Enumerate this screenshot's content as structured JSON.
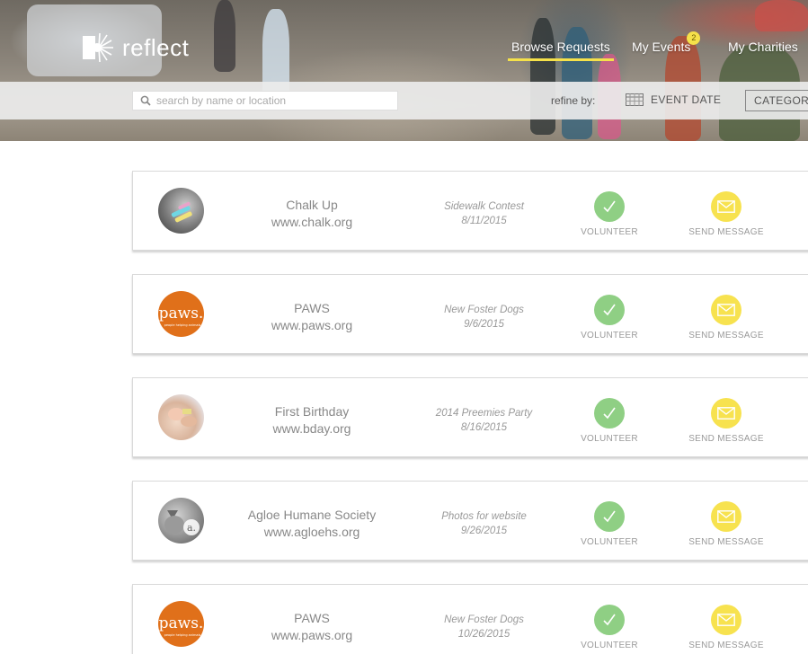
{
  "app": {
    "name": "reflect"
  },
  "nav": {
    "items": [
      {
        "label": "Browse Requests",
        "active": true
      },
      {
        "label": "My Events",
        "badge": "2"
      },
      {
        "label": "My Charities"
      }
    ]
  },
  "filters": {
    "search_placeholder": "search by name or location",
    "refine_label": "refine by:",
    "event_date_label": "EVENT DATE",
    "category_label": "CATEGORY"
  },
  "actions": {
    "volunteer_label": "VOLUNTEER",
    "message_label": "SEND MESSAGE"
  },
  "requests": [
    {
      "name": "Chalk Up",
      "url": "www.chalk.org",
      "event": "Sidewalk Contest",
      "date": "8/11/2015",
      "avatar": "chalk-photo"
    },
    {
      "name": "PAWS",
      "url": "www.paws.org",
      "event": "New Foster Dogs",
      "date": "9/6/2015",
      "avatar": "paws-logo",
      "logo_text": "paws.",
      "logo_tagline": "people helping animals"
    },
    {
      "name": "First Birthday",
      "url": "www.bday.org",
      "event": "2014 Preemies Party",
      "date": "8/16/2015",
      "avatar": "baby-photo"
    },
    {
      "name": "Agloe Humane Society",
      "url": "www.agloehs.org",
      "event": "Photos for website",
      "date": "9/26/2015",
      "avatar": "cat-photo",
      "logo_text": "a."
    },
    {
      "name": "PAWS",
      "url": "www.paws.org",
      "event": "New Foster Dogs",
      "date": "10/26/2015",
      "avatar": "paws-logo",
      "logo_text": "paws.",
      "logo_tagline": "people helping animals"
    }
  ],
  "colors": {
    "accent_yellow": "#f5e14a",
    "volunteer_green": "#8fcf84",
    "message_yellow": "#f7e24f",
    "paws_orange": "#e0701a"
  }
}
